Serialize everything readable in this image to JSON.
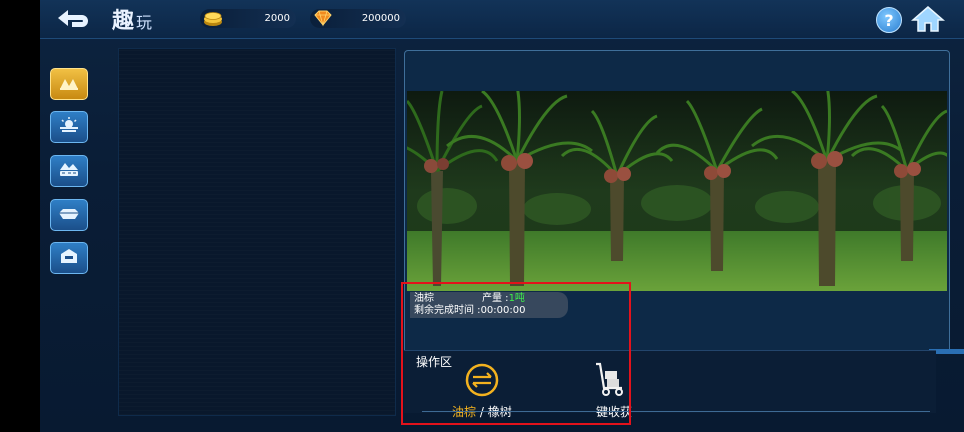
{
  "header": {
    "title_main": "趣",
    "title_sub": "玩",
    "gold": {
      "value": "2000",
      "icon": "gold-coins-icon"
    },
    "gem": {
      "value": "200000",
      "icon": "gem-icon"
    }
  },
  "sidebar": {
    "items": [
      {
        "icon": "plantation-icon",
        "active": true
      },
      {
        "icon": "sunrise-farm-icon",
        "active": false
      },
      {
        "icon": "pond-icon",
        "active": false
      },
      {
        "icon": "tray-icon",
        "active": false
      },
      {
        "icon": "storage-icon",
        "active": false
      }
    ]
  },
  "crop": {
    "name": "油棕",
    "yield_label": "产量 :",
    "yield_value": "1吨",
    "remaining_label": "剩余完成时间 :",
    "remaining_time": "00:00:00"
  },
  "operations": {
    "title": "操作区",
    "switch": {
      "highlight": "油棕",
      "separator": "/",
      "other": "橡树"
    },
    "harvest_label": "一键收获"
  },
  "colors": {
    "accent_gold": "#f3b21f",
    "yield_green": "#3df04a",
    "annotation_red": "#e3121b"
  }
}
